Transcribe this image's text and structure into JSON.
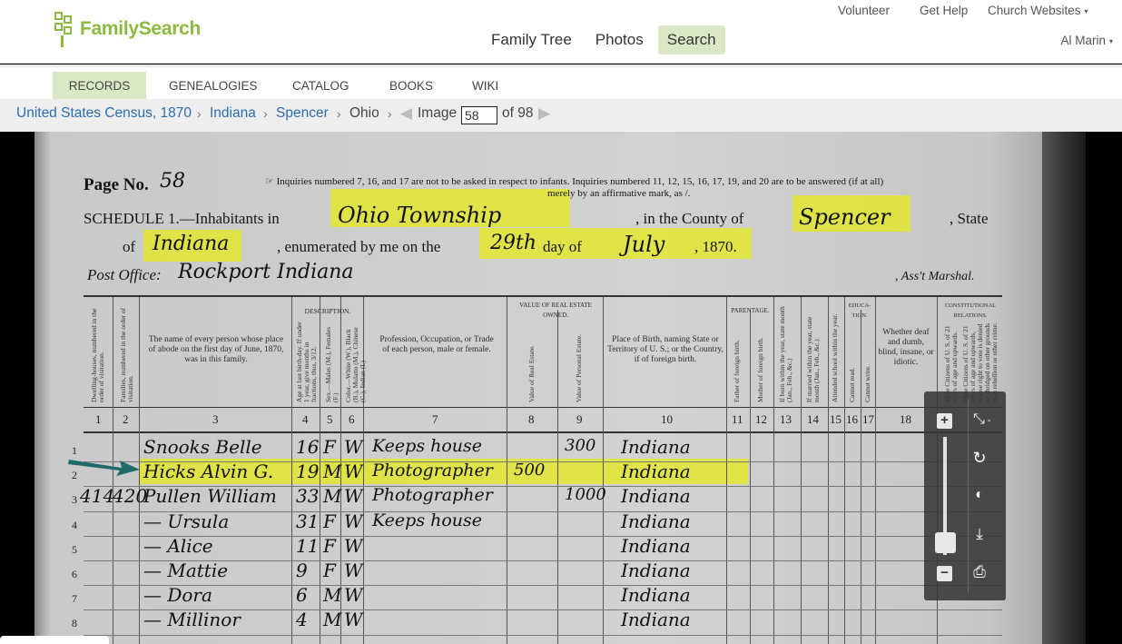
{
  "header": {
    "logo_text": "FamilySearch",
    "utility": {
      "volunteer": "Volunteer",
      "get_help": "Get Help",
      "church_websites": "Church Websites"
    },
    "nav": {
      "family_tree": "Family Tree",
      "photos": "Photos",
      "search": "Search"
    },
    "user_name": "Al Marin",
    "caret": "▾"
  },
  "subnav": {
    "records": "RECORDS",
    "genealogies": "GENEALOGIES",
    "catalog": "CATALOG",
    "books": "BOOKS",
    "wiki": "WIKI"
  },
  "breadcrumb": {
    "collection": "United States Census, 1870",
    "state": "Indiana",
    "county": "Spencer",
    "township": "Ohio",
    "separator": "›",
    "image_label": "Image",
    "image_number": "58",
    "of_total": "of 98"
  },
  "document": {
    "page_no_label": "Page No.",
    "page_no": "58",
    "inquiries_line1": "☞ Inquiries numbered 7, 16, and 17 are not to be asked in respect to infants.   Inquiries numbered 11, 12, 15, 16, 17, 19, and 20 are to be answered (if at all)",
    "inquiries_line2": "merely by an affirmative mark, as /.",
    "schedule_label": "SCHEDULE 1.—Inhabitants in",
    "township": "Ohio Township",
    "county_label": ", in the County of",
    "county": "Spencer",
    "state_label": ", State",
    "of_label": "of",
    "state": "Indiana",
    "enumerated_label": ", enumerated by me on the",
    "day": "29th",
    "day_label": "day of",
    "month": "July",
    "year_label": ", 1870.",
    "post_office_label": "Post Office:",
    "post_office": "Rockport Indiana",
    "marshal_label": ", Ass't Marshal.",
    "headers": {
      "description": "DESCRIPTION.",
      "value_real_estate": "VALUE OF REAL ESTATE OWNED.",
      "parentage": "PARENTAGE.",
      "education": "EDUCA-TION.",
      "constitutional": "CONSTITUTIONAL RELATIONS.",
      "col3": "The name of every person whose place of abode on the first day of June, 1870, was in this family.",
      "col7": "Profession, Occupation, or Trade of each person, male or female.",
      "col10": "Place of Birth, naming State or Territory of U. S.; or the Country, if of foreign birth.",
      "col18": "Whether deaf and dumb, blind, insane, or idiotic.",
      "v1": "Dwelling-houses, numbered in the order of visitation.",
      "v2": "Families, numbered in the order of visitation.",
      "v4": "Age at last birth-day. If under 1 year, give months in fractions, thus, 3/12.",
      "v5": "Sex.—Males (M.), Females (F.)",
      "v6": "Color.—White (W.), Black (B.), Mulatto (M.), Chinese (C.), Indian (I.)",
      "v8": "Value of Real Estate.",
      "v9": "Value of Personal Estate.",
      "v11": "Father of foreign birth.",
      "v12": "Mother of foreign birth.",
      "v13": "If born within the year, state month (Jan., Feb., &c.)",
      "v14": "If married within the year, state month (Jan., Feb., &c.)",
      "v15": "Attended school within the year.",
      "v16": "Cannot read.",
      "v17": "Cannot write.",
      "v19": "Male Citizens of U. S. of 21 years of age and upwards.",
      "v20": "Male Citizens of U. S. of 21 years of age and upwards, whose right to vote is denied or abridged on other grounds than rebellion or other crime."
    },
    "column_numbers": [
      "1",
      "2",
      "3",
      "4",
      "5",
      "6",
      "7",
      "8",
      "9",
      "10",
      "11",
      "12",
      "13",
      "14",
      "15",
      "16",
      "17",
      "18"
    ],
    "rows": [
      {
        "num": "1",
        "dwelling": "",
        "family": "",
        "name": "Snooks Belle",
        "age": "16",
        "sex": "F",
        "color": "W",
        "occupation": "Keeps house",
        "real_estate": "",
        "personal_estate": "300",
        "birthplace": "Indiana"
      },
      {
        "num": "2",
        "dwelling": "",
        "family": "",
        "name": "Hicks Alvin G.",
        "age": "19",
        "sex": "M",
        "color": "W",
        "occupation": "Photographer",
        "real_estate": "500",
        "personal_estate": "",
        "birthplace": "Indiana"
      },
      {
        "num": "3",
        "dwelling": "414",
        "family": "420",
        "name": "Pullen William",
        "age": "33",
        "sex": "M",
        "color": "W",
        "occupation": "Photographer",
        "real_estate": "",
        "personal_estate": "1000",
        "birthplace": "Indiana"
      },
      {
        "num": "4",
        "dwelling": "",
        "family": "",
        "name": "— Ursula",
        "age": "31",
        "sex": "F",
        "color": "W",
        "occupation": "Keeps house",
        "real_estate": "",
        "personal_estate": "",
        "birthplace": "Indiana"
      },
      {
        "num": "5",
        "dwelling": "",
        "family": "",
        "name": "— Alice",
        "age": "11",
        "sex": "F",
        "color": "W",
        "occupation": "",
        "real_estate": "",
        "personal_estate": "",
        "birthplace": "Indiana"
      },
      {
        "num": "6",
        "dwelling": "",
        "family": "",
        "name": "— Mattie",
        "age": "9",
        "sex": "F",
        "color": "W",
        "occupation": "",
        "real_estate": "",
        "personal_estate": "",
        "birthplace": "Indiana"
      },
      {
        "num": "7",
        "dwelling": "",
        "family": "",
        "name": "— Dora",
        "age": "6",
        "sex": "M",
        "color": "W",
        "occupation": "",
        "real_estate": "",
        "personal_estate": "",
        "birthplace": "Indiana"
      },
      {
        "num": "8",
        "dwelling": "",
        "family": "",
        "name": "— Millinor",
        "age": "4",
        "sex": "M",
        "color": "W",
        "occupation": "",
        "real_estate": "",
        "personal_estate": "",
        "birthplace": "Indiana"
      }
    ]
  },
  "toolbar": {
    "zoom_in": "+",
    "zoom_out": "−",
    "fit": "⤡",
    "fit_minus": "-",
    "rotate": "↻",
    "contrast": "◐",
    "download": "⤓",
    "print": "⎙"
  },
  "colors": {
    "brand_green": "#8cb940",
    "active_tab_bg": "#dbe8c5",
    "link": "#2a6db0",
    "highlight": "#e6ec14",
    "arrow": "#1f6b6b"
  }
}
